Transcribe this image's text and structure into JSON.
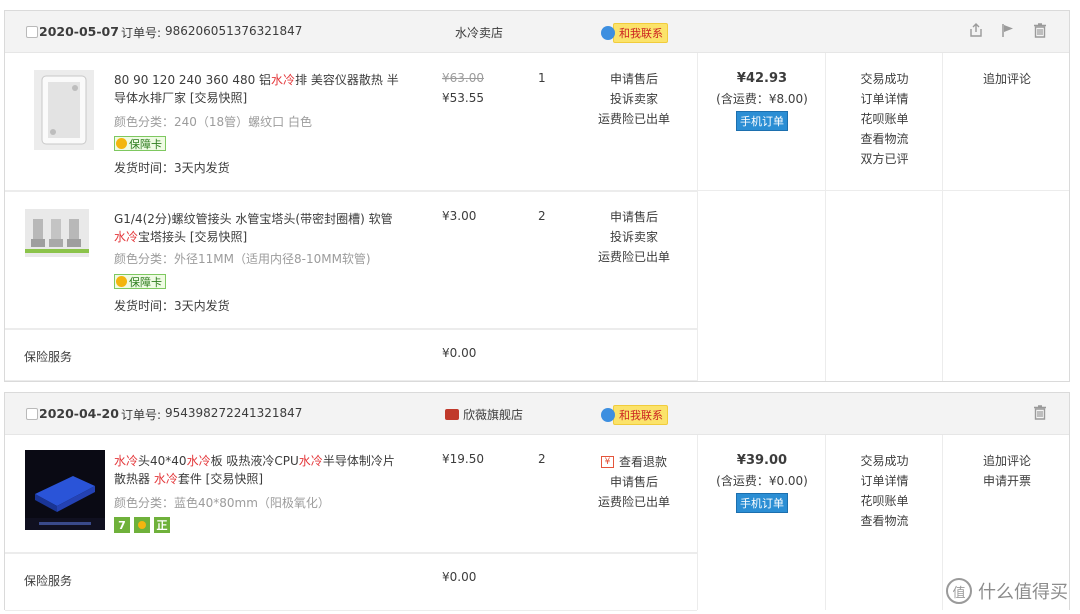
{
  "orders": [
    {
      "date": "2020-05-07",
      "order_id_label": "订单号:",
      "order_id": "986206051376321847",
      "shop": "水冷卖店",
      "contact_label": "和我联系",
      "items": [
        {
          "title_parts": [
            "80 90 120 240 360 480 铝",
            "水冷",
            "排 美容仪器散热 半导体水排厂家 [交易快照]"
          ],
          "spec": "颜色分类：240（18管）螺纹口 白色",
          "badge": "保障卡",
          "ship": "发货时间：3天内发货",
          "price_old": "¥63.00",
          "price": "¥53.55",
          "qty": "1",
          "services": [
            "申请售后",
            "投诉卖家",
            "运费险已出单"
          ]
        },
        {
          "title_parts": [
            "G1/4(2分)螺纹管接头 水管宝塔头(带密封圈槽) 软管",
            "水冷",
            "宝塔接头 [交易快照]"
          ],
          "spec": "颜色分类：外径11MM（适用内径8-10MM软管)",
          "badge": "保障卡",
          "ship": "发货时间：3天内发货",
          "price": "¥3.00",
          "qty": "2",
          "services": [
            "申请售后",
            "投诉卖家",
            "运费险已出单"
          ]
        }
      ],
      "insurance_label": "保险服务",
      "insurance_price": "¥0.00",
      "total": "¥42.93",
      "shipping_fee": "(含运费：¥8.00)",
      "mobile_tag": "手机订单",
      "status": [
        "交易成功",
        "订单详情",
        "花呗账单",
        "查看物流",
        "双方已评"
      ],
      "ops": [
        "追加评论"
      ]
    },
    {
      "date": "2020-04-20",
      "order_id_label": "订单号:",
      "order_id": "954398272241321847",
      "shop": "欣薇旗舰店",
      "contact_label": "和我联系",
      "items": [
        {
          "title_parts": [
            "",
            "水冷",
            "头40*40",
            "水冷",
            "板 吸热液冷CPU",
            "水冷",
            "半导体制冷片散热器 ",
            "水冷",
            "套件 [交易快照]"
          ],
          "spec": "颜色分类：蓝色40*80mm（阳极氧化）",
          "price": "¥19.50",
          "qty": "2",
          "refund_label": "查看退款",
          "services": [
            "申请售后",
            "运费险已出单"
          ]
        }
      ],
      "insurance_label": "保险服务",
      "insurance_price": "¥0.00",
      "total": "¥39.00",
      "shipping_fee": "(含运费：¥0.00)",
      "mobile_tag": "手机订单",
      "status": [
        "交易成功",
        "订单详情",
        "花呗账单",
        "查看物流"
      ],
      "ops": [
        "追加评论",
        "申请开票"
      ]
    }
  ],
  "watermark": "什么值得买",
  "watermark_icon": "值",
  "badge_icons": [
    "7",
    "正"
  ],
  "colors": {
    "highlight": "#e4393c",
    "mobile_tag": "#2b8ed4",
    "header_bg": "#f3f3f3"
  }
}
